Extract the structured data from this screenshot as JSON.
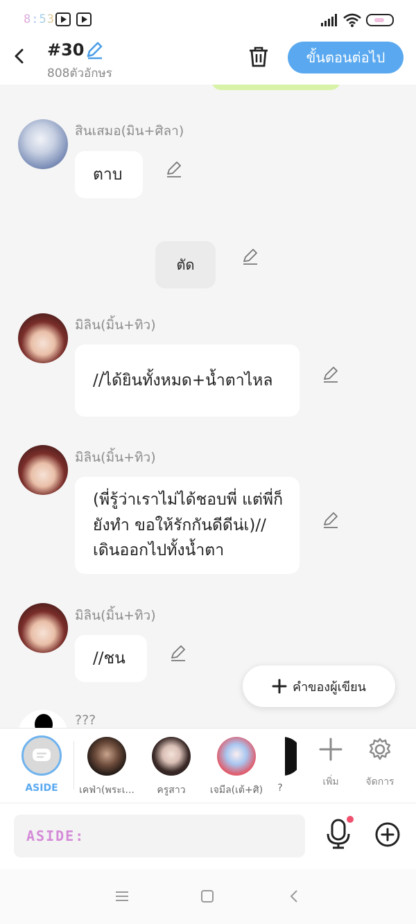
{
  "status_bar": {
    "time": "8:53"
  },
  "header": {
    "episode": "#30",
    "char_count": "808ตัวอักษร",
    "next_button": "ขั้นตอนต่อไป"
  },
  "messages": [
    {
      "name": "สินเสมอ(มิน+ศิลา)",
      "text": "ตาบ"
    },
    {
      "narration": "ตัด"
    },
    {
      "name": "มิลิน(มิ้น+ทิว)",
      "text": "//ได้ยินทั้งหมด+น้ำตาไหล"
    },
    {
      "name": "มิลิน(มิ้น+ทิว)",
      "text": "(พี่รู้ว่าเราไม่ได้ชอบพี่ แต่พี่ก็ยังทำ ขอให้รักกันดีดีน่เ)//เดินออกไปทั้งน้ำตา"
    },
    {
      "name": "มิลิน(มิ้น+ทิว)",
      "text": "//ชน"
    },
    {
      "name": "???"
    }
  ],
  "author_button": "คำของผู้เขียน",
  "characters": [
    {
      "label": "ASIDE"
    },
    {
      "label": "เคฟ่า(พระเ..."
    },
    {
      "label": "ครูสาว"
    },
    {
      "label": "เจมีล(เต้+ศิ)"
    },
    {
      "label": "?"
    }
  ],
  "tools": {
    "add": "เพิ่ม",
    "manage": "จัดการ"
  },
  "input": {
    "placeholder": "ASIDE:"
  },
  "colors": {
    "accent": "#5aa9f0",
    "bubble": "#ffffff",
    "background": "#f5f5f5"
  }
}
